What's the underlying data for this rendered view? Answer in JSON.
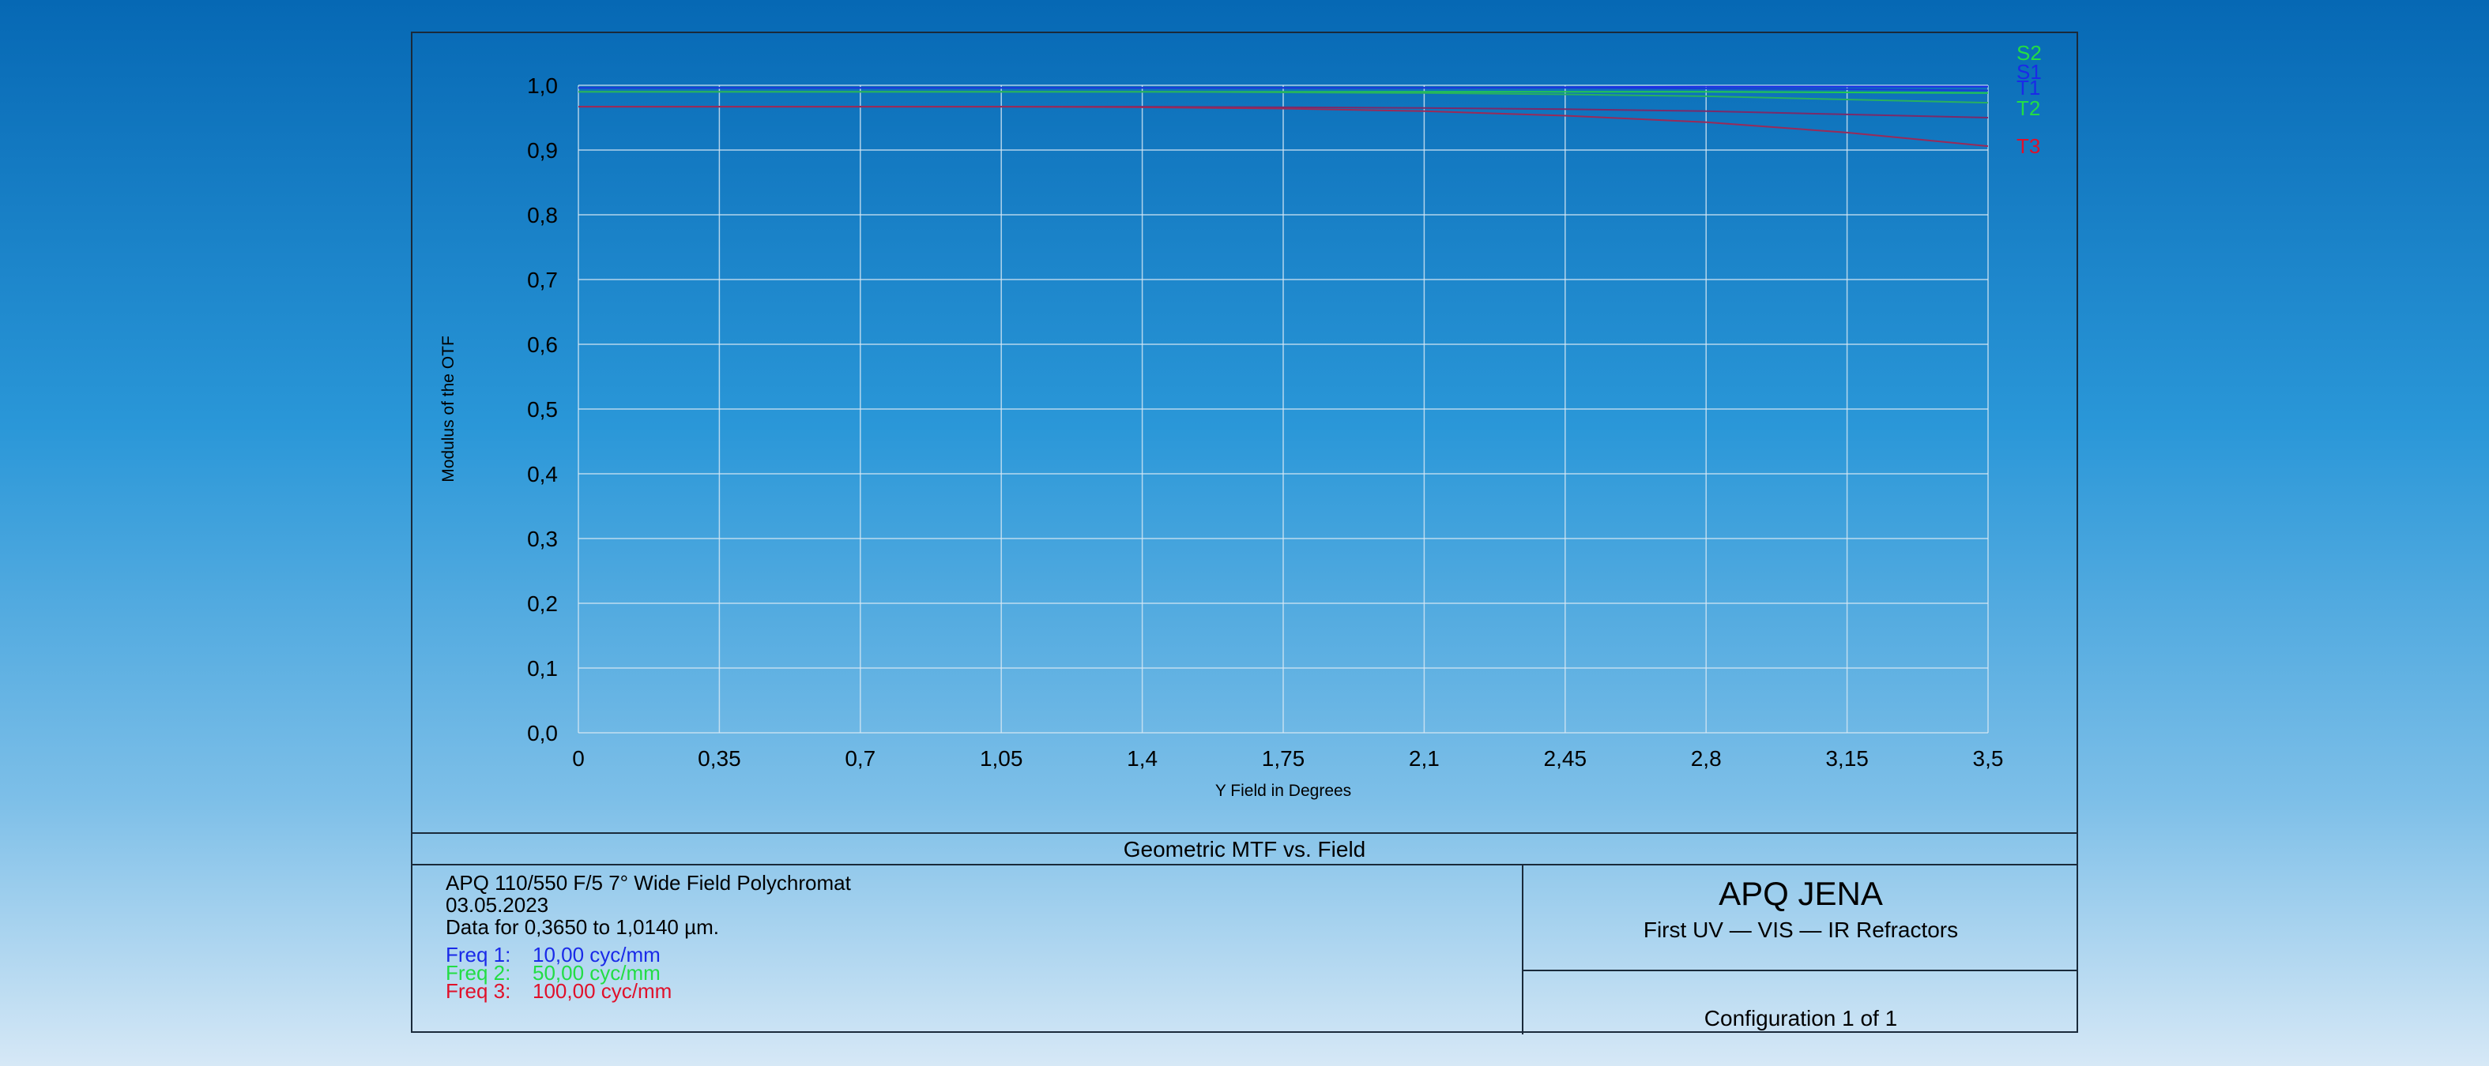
{
  "colors": {
    "freq1": "#1a2ae8",
    "freq2": "#22dd44",
    "freq3": "#e0102a",
    "grid": "#d8e8f4",
    "line_s1": "#1a2ae8",
    "line_t1": "#1a3ad8",
    "line_s2": "#22c850",
    "line_t2": "#28b060",
    "line_s3": "#7a2a6a",
    "line_t3": "#9a2a58"
  },
  "chart_data": {
    "type": "line",
    "title": "Geometric MTF vs. Field",
    "xlabel": "Y Field in Degrees",
    "ylabel": "Modulus of the OTF",
    "xlim": [
      0,
      3.5
    ],
    "ylim": [
      0,
      1.0
    ],
    "x_ticks": [
      0,
      0.35,
      0.7,
      1.05,
      1.4,
      1.75,
      2.1,
      2.45,
      2.8,
      3.15,
      3.5
    ],
    "x_tick_labels": [
      "0",
      "0,35",
      "0,7",
      "1,05",
      "1,4",
      "1,75",
      "2,1",
      "2,45",
      "2,8",
      "3,15",
      "3,5"
    ],
    "y_ticks": [
      0,
      0.1,
      0.2,
      0.3,
      0.4,
      0.5,
      0.6,
      0.7,
      0.8,
      0.9,
      1.0
    ],
    "y_tick_labels": [
      "0,0",
      "0,1",
      "0,2",
      "0,3",
      "0,4",
      "0,5",
      "0,6",
      "0,7",
      "0,8",
      "0,9",
      "1,0"
    ],
    "grid": true,
    "x": [
      0,
      0.35,
      0.7,
      1.05,
      1.4,
      1.75,
      2.1,
      2.45,
      2.8,
      3.15,
      3.5
    ],
    "series": [
      {
        "name": "S1",
        "color": "line_s1",
        "values": [
          0.996,
          0.996,
          0.996,
          0.996,
          0.996,
          0.996,
          0.996,
          0.997,
          0.998,
          0.998,
          0.998
        ]
      },
      {
        "name": "T1",
        "color": "line_t1",
        "values": [
          0.996,
          0.996,
          0.996,
          0.996,
          0.996,
          0.996,
          0.996,
          0.996,
          0.995,
          0.994,
          0.992
        ]
      },
      {
        "name": "S2",
        "color": "line_s2",
        "values": [
          0.99,
          0.99,
          0.99,
          0.99,
          0.99,
          0.99,
          0.99,
          0.99,
          0.99,
          0.989,
          0.988
        ]
      },
      {
        "name": "T2",
        "color": "line_t2",
        "values": [
          0.99,
          0.99,
          0.99,
          0.99,
          0.99,
          0.989,
          0.988,
          0.986,
          0.983,
          0.978,
          0.973
        ]
      },
      {
        "name": "",
        "color": "line_s3",
        "values": [
          0.967,
          0.967,
          0.967,
          0.967,
          0.967,
          0.966,
          0.965,
          0.963,
          0.96,
          0.955,
          0.95
        ]
      },
      {
        "name": "T3",
        "color": "line_t3",
        "values": [
          0.967,
          0.967,
          0.967,
          0.967,
          0.966,
          0.964,
          0.96,
          0.953,
          0.943,
          0.927,
          0.906
        ]
      }
    ],
    "legend_labels": [
      {
        "text": "S2",
        "color": "freq2"
      },
      {
        "text": "S1",
        "color": "freq1"
      },
      {
        "text": "T1",
        "color": "freq1"
      },
      {
        "text": "T2",
        "color": "freq2"
      },
      {
        "text": "T3",
        "color": "freq3"
      }
    ]
  },
  "info": {
    "line1": "APQ 110/550 F/5 7° Wide Field Polychromat",
    "line2": "03.05.2023",
    "line3": "Data for 0,3650 to 1,0140 µm.",
    "freqs": [
      {
        "label": "Freq 1:",
        "value": "10,00 cyc/mm"
      },
      {
        "label": "Freq 2:",
        "value": "50,00 cyc/mm"
      },
      {
        "label": "Freq 3:",
        "value": "100,00 cyc/mm"
      }
    ]
  },
  "brand": {
    "title": "APQ JENA",
    "subtitle": "First UV — VIS — IR Refractors"
  },
  "config": "Configuration 1 of 1"
}
